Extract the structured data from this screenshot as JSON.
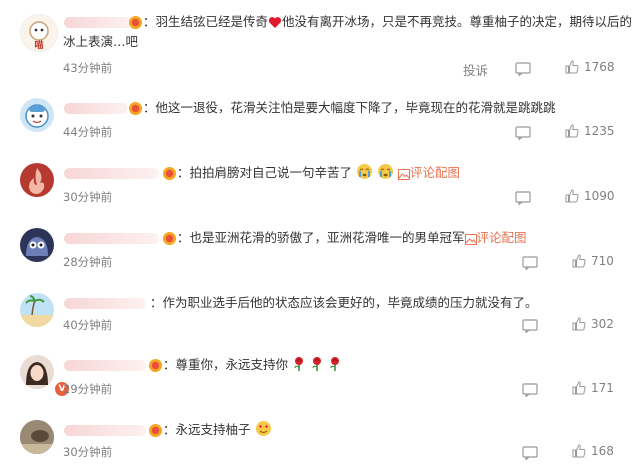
{
  "comments": [
    {
      "text_line1": "：羽生结弦已经是传奇",
      "text_after_heart": "他没有离开冰场，只是不再竞技。尊重柚子的决定，期待以后的",
      "text_line2": "冰上表演…吧",
      "time": "43分钟前",
      "report": "投诉",
      "likes": "1768"
    },
    {
      "text": "：他这一退役，花滑关注怕是要大幅度下降了，毕竟现在的花滑就是跳跳跳",
      "time": "44分钟前",
      "likes": "1235"
    },
    {
      "text": "：拍拍肩膀对自己说一句辛苦了",
      "link": "评论配图",
      "time": "30分钟前",
      "likes": "1090"
    },
    {
      "text": "：也是亚洲花滑的骄傲了，亚洲花滑唯一的男单冠军",
      "link": "评论配图",
      "time": "28分钟前",
      "likes": "710"
    },
    {
      "text": "：作为职业选手后他的状态应该会更好的，毕竟成绩的压力就没有了。",
      "time": "40分钟前",
      "likes": "302"
    },
    {
      "text": "：尊重你，永远支持你",
      "time": "29分钟前",
      "likes": "171"
    },
    {
      "text": "：永远支持柚子",
      "time": "30分钟前",
      "likes": "168"
    }
  ],
  "colors": {
    "link": "#eb7350",
    "meta": "#808080",
    "heart": "#e0192e"
  }
}
